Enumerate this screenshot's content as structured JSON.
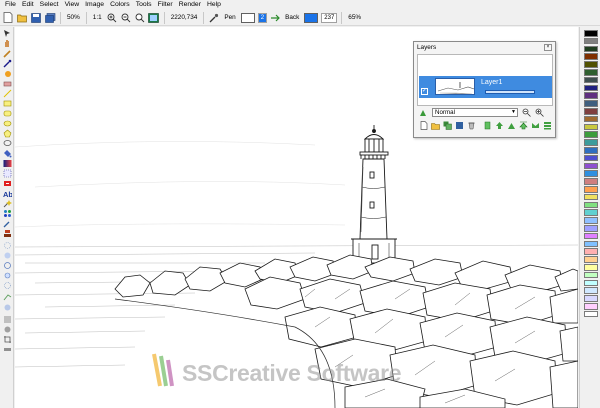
{
  "menu": [
    "File",
    "Edit",
    "Select",
    "View",
    "Image",
    "Colors",
    "Tools",
    "Filter",
    "Render",
    "Help"
  ],
  "toolbar": {
    "zoom_percent": "50%",
    "zoom_actual": "1:1",
    "coords": "2220,734",
    "pen_label": "Pen",
    "pen_value": "2",
    "back_label": "Back",
    "back_value": "237",
    "opacity_percent": "65%",
    "pen_color": "#ffffff",
    "back_color": "#1a73e8"
  },
  "layers_panel": {
    "title": "Layers",
    "layer_name": "Layer1",
    "blend_mode": "Normal",
    "selection_color": "#3f8be0"
  },
  "palette": [
    "#000000",
    "#7f7f7f",
    "#1f3d1f",
    "#7f2f00",
    "#4f4f00",
    "#2f5f2f",
    "#3f4f4f",
    "#1f1f7f",
    "#5f2f7f",
    "#3f5f7f",
    "#7f3f3f",
    "#a06a30",
    "#c8c840",
    "#3c9c3c",
    "#3c9c9c",
    "#2f6fbf",
    "#4f4fcf",
    "#8f4fcf",
    "#2f8fdf",
    "#cf7f7f",
    "#ffa050",
    "#f0e060",
    "#80e080",
    "#60d0d0",
    "#90c0ff",
    "#a0a0ff",
    "#e080ff",
    "#80c0ff",
    "#ffb0b0",
    "#ffd090",
    "#ffffa0",
    "#c0ffc0",
    "#c0ffff",
    "#d0e8ff",
    "#d8d8ff",
    "#ffd0ff",
    "#ffffff"
  ],
  "watermark": "SSCreative Software"
}
